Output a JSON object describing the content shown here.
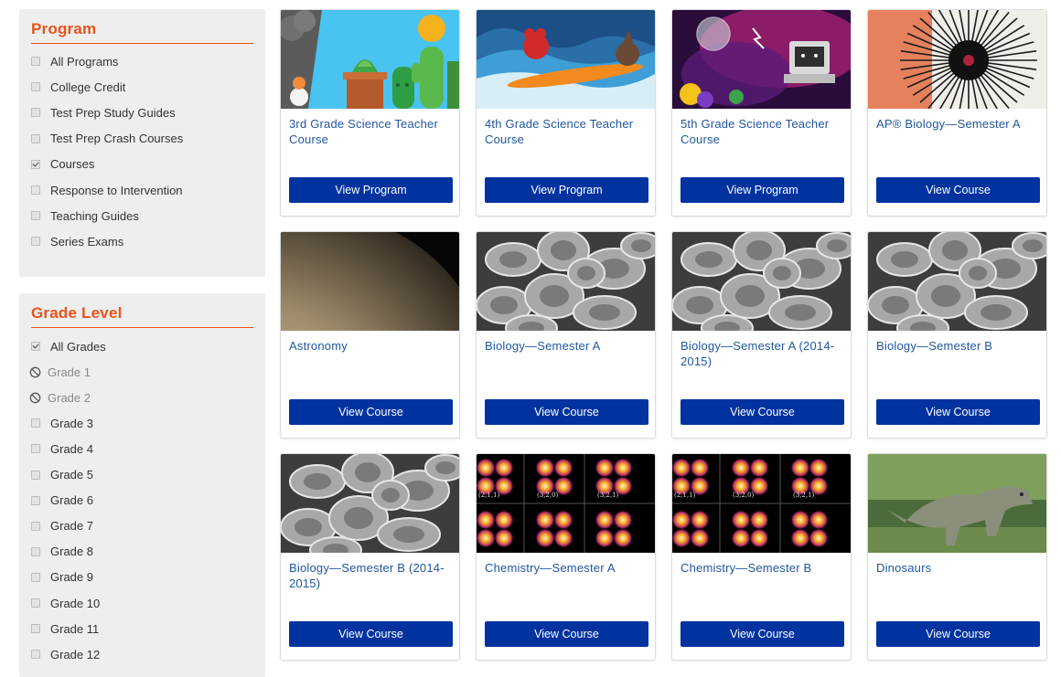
{
  "filters": {
    "program": {
      "title": "Program",
      "options": [
        {
          "label": "All Programs",
          "checked": false
        },
        {
          "label": "College Credit",
          "checked": false
        },
        {
          "label": "Test Prep Study Guides",
          "checked": false
        },
        {
          "label": "Test Prep Crash Courses",
          "checked": false
        },
        {
          "label": "Courses",
          "checked": true
        },
        {
          "label": "Response to Intervention",
          "checked": false
        },
        {
          "label": "Teaching Guides",
          "checked": false
        },
        {
          "label": "Series Exams",
          "checked": false
        }
      ]
    },
    "grade": {
      "title": "Grade Level",
      "options": [
        {
          "label": "All Grades",
          "state": "checked"
        },
        {
          "label": "Grade 1",
          "state": "disabled"
        },
        {
          "label": "Grade 2",
          "state": "disabled"
        },
        {
          "label": "Grade 3",
          "state": "unchecked"
        },
        {
          "label": "Grade 4",
          "state": "unchecked"
        },
        {
          "label": "Grade 5",
          "state": "unchecked"
        },
        {
          "label": "Grade 6",
          "state": "unchecked"
        },
        {
          "label": "Grade 7",
          "state": "unchecked"
        },
        {
          "label": "Grade 8",
          "state": "unchecked"
        },
        {
          "label": "Grade 9",
          "state": "unchecked"
        },
        {
          "label": "Grade 10",
          "state": "unchecked"
        },
        {
          "label": "Grade 11",
          "state": "unchecked"
        },
        {
          "label": "Grade 12",
          "state": "unchecked"
        }
      ]
    }
  },
  "cards": [
    {
      "title": "3rd Grade Science Teacher Course",
      "button": "View Program",
      "image": "cartoon-cacti"
    },
    {
      "title": "4th Grade Science Teacher Course",
      "button": "View Program",
      "image": "surfing-wave"
    },
    {
      "title": "5th Grade Science Teacher Course",
      "button": "View Program",
      "image": "space-computer"
    },
    {
      "title": "AP® Biology—Semester A",
      "button": "View Course",
      "image": "sea-urchin"
    },
    {
      "title": "Astronomy",
      "button": "View Course",
      "image": "planet"
    },
    {
      "title": "Biology—Semester A",
      "button": "View Course",
      "image": "blood-cells"
    },
    {
      "title": "Biology—Semester A (2014-2015)",
      "button": "View Course",
      "image": "blood-cells"
    },
    {
      "title": "Biology—Semester B",
      "button": "View Course",
      "image": "blood-cells"
    },
    {
      "title": "Biology—Semester B (2014-2015)",
      "button": "View Course",
      "image": "blood-cells"
    },
    {
      "title": "Chemistry—Semester A",
      "button": "View Course",
      "image": "orbitals"
    },
    {
      "title": "Chemistry—Semester B",
      "button": "View Course",
      "image": "orbitals"
    },
    {
      "title": "Dinosaurs",
      "button": "View Course",
      "image": "dinosaur"
    }
  ],
  "orbital_labels": [
    "(2,1,1)",
    "(3,2,0)",
    "(3,2,1)"
  ],
  "colors": {
    "accent": "#e8531b",
    "button": "#0033a0",
    "link": "#1f56a0",
    "panel": "#eeeeee"
  }
}
